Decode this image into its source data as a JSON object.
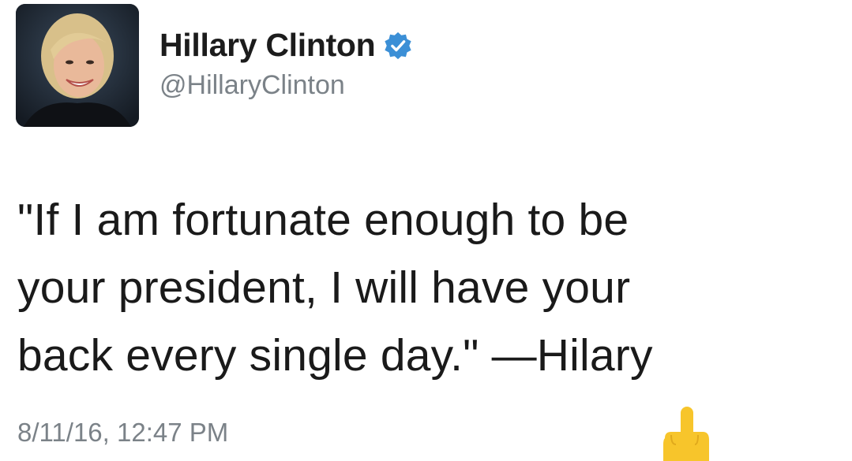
{
  "tweet": {
    "author": {
      "display_name": "Hillary Clinton",
      "handle": "@HillaryClinton",
      "verified": true,
      "avatar_icon": "profile-photo"
    },
    "text_lines": [
      "\"If I am fortunate enough to be",
      "your president, I will have your",
      "back every single day.\" —Hilary"
    ],
    "timestamp": "8/11/16, 12:47 PM",
    "emoji": "middle-finger-emoji"
  },
  "colors": {
    "verified_blue": "#1da1f2",
    "secondary_text": "#7b8288",
    "emoji_yellow": "#f7c52b"
  }
}
